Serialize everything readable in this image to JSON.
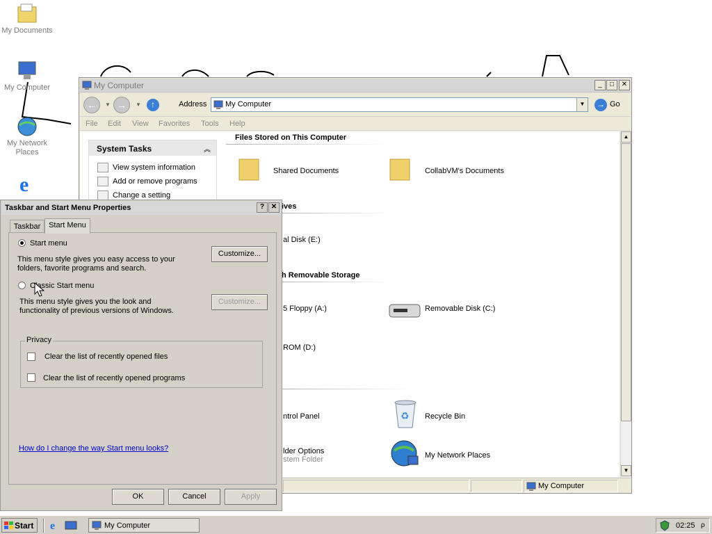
{
  "desktop": {
    "icons": [
      {
        "label": "My Documents"
      },
      {
        "label": "My Computer"
      },
      {
        "label": "My Network Places"
      },
      {
        "label": "Internet Explorer"
      }
    ]
  },
  "explorer": {
    "title": "My Computer",
    "address_label": "Address",
    "address_value": "My Computer",
    "go_label": "Go",
    "menu": [
      "File",
      "Edit",
      "View",
      "Favorites",
      "Tools",
      "Help"
    ],
    "system_tasks": {
      "title": "System Tasks",
      "items": [
        "View system information",
        "Add or remove programs",
        "Change a setting"
      ]
    },
    "sections": {
      "stored": "Files Stored on This Computer",
      "drives_partial": "ives",
      "removable_partial": "h Removable Storage"
    },
    "items": {
      "shared_docs": "Shared Documents",
      "collab_docs": "CollabVM's Documents",
      "local_disk_partial": "al Disk (E:)",
      "floppy_partial": "5 Floppy (A:)",
      "removable_disk": "Removable Disk (C:)",
      "cdrom_partial": "ROM (D:)",
      "control_panel_partial": "ntrol Panel",
      "recycle_bin": "Recycle Bin",
      "folder_options_partial": "lder Options",
      "system_folder_partial": "stem Folder",
      "network_places": "My Network Places"
    },
    "status": "My Computer"
  },
  "dialog": {
    "title": "Taskbar and Start Menu Properties",
    "tabs": [
      "Taskbar",
      "Start Menu"
    ],
    "start_menu_label": "Start menu",
    "start_menu_desc_1": "This menu style gives you easy access to your",
    "start_menu_desc_2": "folders, favorite programs and search.",
    "customize_label": "Customize...",
    "classic_label": "Classic Start menu",
    "classic_desc_1": "This menu style gives you the look and",
    "classic_desc_2": "functionality of previous versions of Windows.",
    "customize_disabled_label": "Customize...",
    "privacy_label": "Privacy",
    "clear_files": "Clear the list of recently opened files",
    "clear_programs": "Clear the list of recently opened programs",
    "help_link": "How do I change the way Start menu looks?",
    "ok": "OK",
    "cancel": "Cancel",
    "apply": "Apply"
  },
  "taskbar": {
    "start": "Start",
    "task_window": "My Computer",
    "clock": "02:25"
  }
}
